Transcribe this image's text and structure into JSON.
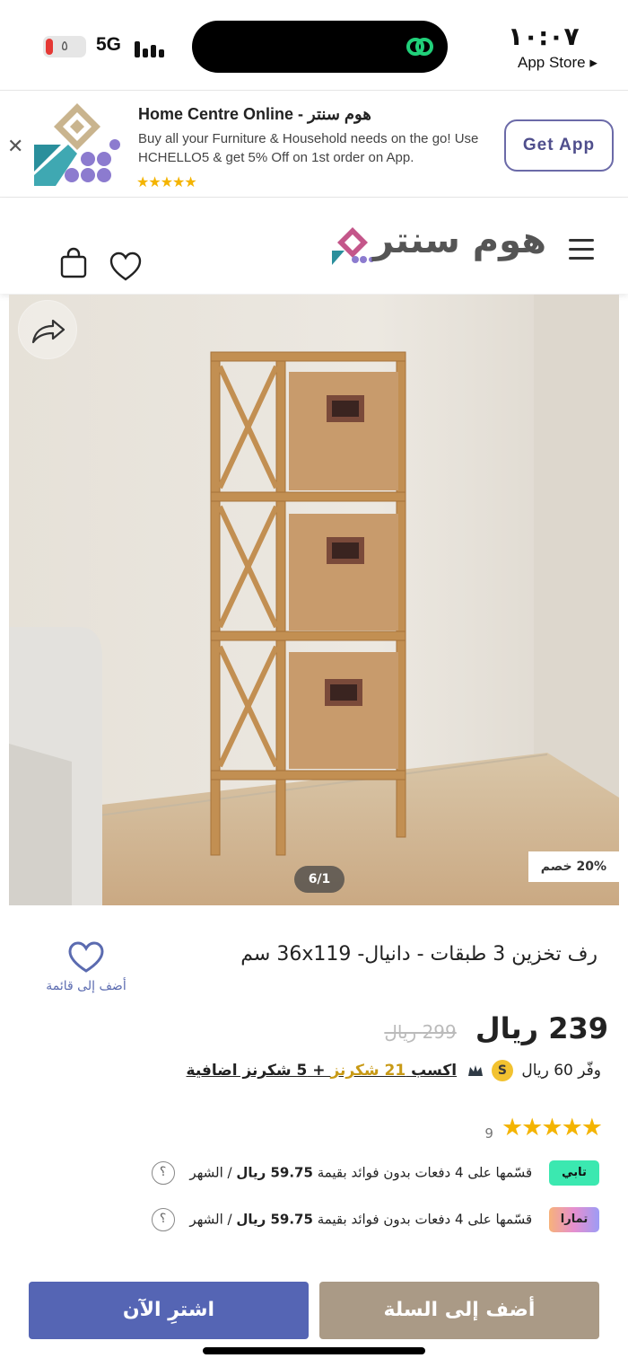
{
  "status_bar": {
    "time": "١٠:٠٧",
    "back_app": "App Store ▸",
    "battery": "٥",
    "network": "5G"
  },
  "app_banner": {
    "title": "Home Centre Online - هوم سنتر",
    "description": "Buy all your Furniture & Household needs on the go! Use HCHELLO5 & get 5% Off on 1st order on App.",
    "stars": "★★★★★",
    "cta": "Get App",
    "close": "✕"
  },
  "header": {
    "logo_text": "هوم سنتر"
  },
  "gallery": {
    "discount_badge": "20% خصم",
    "page_indicator": "6/1"
  },
  "product": {
    "title": "رف تخزين 3 طبقات - دانيال- 36x119 سم",
    "wishlist_label": "أضف إلى قائمة",
    "price": "239 ريال",
    "old_price": "299 ريال",
    "save_prefix": "وفّر",
    "save_amount": "60",
    "save_currency": "ريال",
    "s_badge": "S",
    "shukrans_pre": "اكسب ",
    "shukrans_hl": "21 شكرنز",
    "shukrans_post": " + 5 شكرنز اضافية",
    "rating_stars": "★★★★★",
    "rating_count": "9"
  },
  "installments": [
    {
      "provider": "تابي",
      "text_pre": "قسّمها على 4 دفعات بدون فوائد بقيمة ",
      "amount": "59.75 ريال",
      "text_post": " / الشهر",
      "help": "؟"
    },
    {
      "provider": "تمارا",
      "text_pre": "قسّمها على 4 دفعات بدون فوائد بقيمة ",
      "amount": "59.75 ريال",
      "text_post": " / الشهر",
      "help": "؟"
    }
  ],
  "actions": {
    "buy_now": "اشترِ الآن",
    "add_to_cart": "أضف إلى السلة"
  },
  "colors": {
    "brand_blue": "#5565b4",
    "cart_brown": "#aa9a86",
    "star_gold": "#f4b400",
    "tabby_green": "#3be8b0"
  }
}
